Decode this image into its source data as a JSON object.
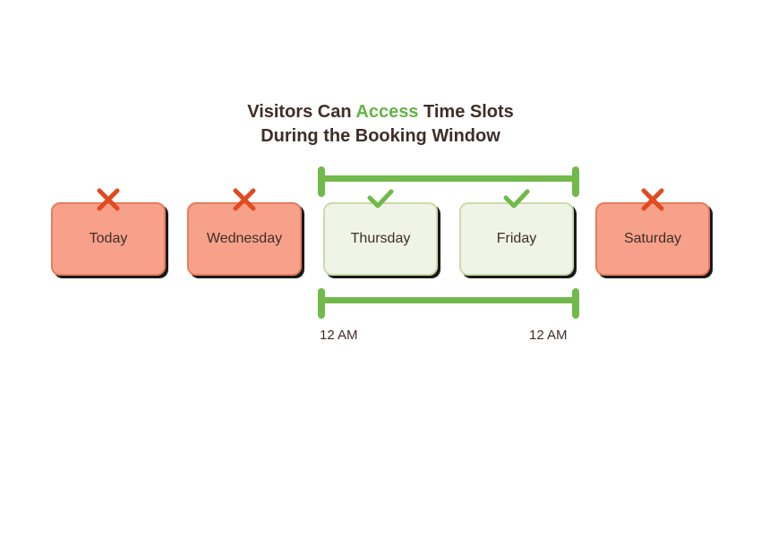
{
  "heading": {
    "part1": "Visitors Can ",
    "access_word": "Access",
    "part2": " Time Slots During the Booking Window"
  },
  "days": [
    {
      "label": "Today",
      "available": false
    },
    {
      "label": "Wednesday",
      "available": false
    },
    {
      "label": "Thursday",
      "available": true
    },
    {
      "label": "Friday",
      "available": true
    },
    {
      "label": "Saturday",
      "available": false
    }
  ],
  "bracket": {
    "start_index": 2,
    "end_index": 3
  },
  "time_labels": {
    "start": "12 AM",
    "end": "12 AM"
  },
  "colors": {
    "green": "#72b94b",
    "red": "#e24a1f",
    "text": "#3e2e28"
  }
}
